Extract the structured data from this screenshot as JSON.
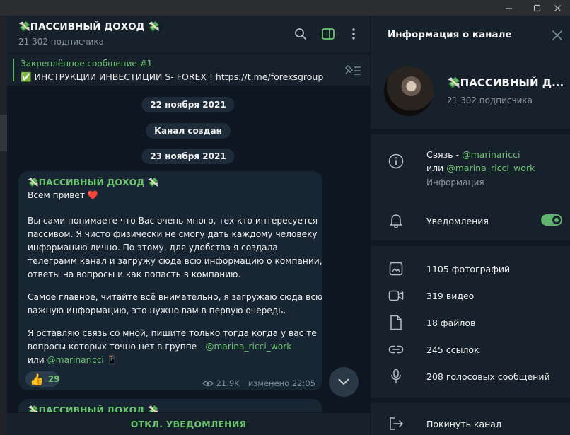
{
  "colors": {
    "accent": "#6cc36e",
    "bg_chat": "#0e1621",
    "bg_panel": "#17212b",
    "bubble": "#182533"
  },
  "window": {
    "minimize_icon": "minimize-icon",
    "maximize_icon": "maximize-icon",
    "close_icon": "close-icon"
  },
  "chat": {
    "title": "💸ПАССИВНЫЙ ДОХОД 💸",
    "subscribers": "21 302 подписчика",
    "header_icons": [
      "search-icon",
      "sidebar-toggle-icon",
      "more-vertical-icon"
    ],
    "pinned": {
      "title": "Закреплённое сообщение #1",
      "text": "✅ ИНСТРУКЦИИ ИНВЕСТИЦИИ  S- FOREX ! https://t.me/forexsgroup"
    },
    "dates": [
      "22 ноября 2021",
      "Канал создан",
      "23 ноября 2021"
    ],
    "message": {
      "author": "💸ПАССИВНЫЙ ДОХОД 💸",
      "greeting": "Всем привет ❤️",
      "lines": [
        "Вы сами понимаете что Вас очень много, тех кто интересуется",
        "пассивом. Я чисто физически не смогу дать каждому человеку",
        "информацию лично. По этому, для удобства я создала",
        "телеграмм канал и загружу сюда всю информацию о компании,",
        "ответы на вопросы и как попасть в компанию.",
        "",
        "Самое главное, читайте всё внимательно, я загружаю сюда всю",
        "важную информацию, это нужно вам в первую очередь.",
        "",
        "Я оставляю связь со мной, пишите только тогда когда у вас те"
      ],
      "line_with_link_prefix": "вопросы которых точно нет в группе - ",
      "link1": "@marina_ricci_work",
      "or_text": "или ",
      "link2": "@marinaricci",
      "phone_emoji": "📱",
      "reaction_emoji": "👍",
      "reaction_count": "29",
      "views": "21.9K",
      "edited_time": "изменено 22:05"
    },
    "next_author": "💸ПАССИВНЫЙ ДОХОД 💸",
    "mute_button": "ОТКЛ. УВЕДОМЛЕНИЯ"
  },
  "info": {
    "title": "Информация о канале",
    "name": "💸ПАССИВНЫЙ Д...",
    "subscribers": "21 302 подписчика",
    "contact_prefix": "Связь - ",
    "contact_link1": "@marinaricci",
    "contact_or": "или ",
    "contact_link2": "@marina_ricci_work",
    "contact_label": "Информация",
    "notifications_label": "Уведомления",
    "notifications_on": true,
    "media": [
      {
        "icon": "photo-icon",
        "label": "1105 фотографий"
      },
      {
        "icon": "video-icon",
        "label": "319 видео"
      },
      {
        "icon": "file-icon",
        "label": "18 файлов"
      },
      {
        "icon": "link-icon",
        "label": "245 ссылок"
      },
      {
        "icon": "microphone-icon",
        "label": "208 голосовых сообщений"
      }
    ],
    "leave_label": "Покинуть канал"
  }
}
